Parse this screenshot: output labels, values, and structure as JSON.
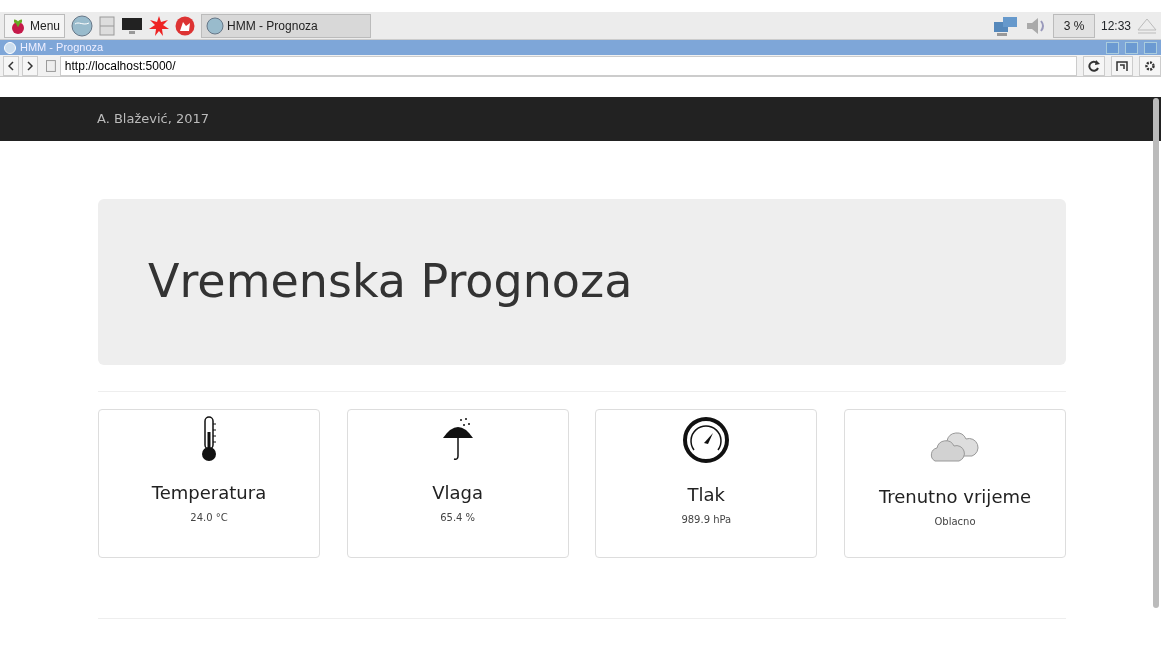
{
  "taskbar": {
    "menu_label": "Menu",
    "window_button": "HMM - Prognoza",
    "cpu": "3 %",
    "clock": "12:33"
  },
  "window": {
    "title": "HMM - Prognoza"
  },
  "browser": {
    "url": "http://localhost:5000/"
  },
  "navbar": {
    "brand": "A. Blažević, 2017"
  },
  "jumbotron": {
    "title": "Vremenska Prognoza"
  },
  "cards": [
    {
      "kind": "thermometer",
      "title": "Temperatura",
      "value": "24.0 °C"
    },
    {
      "kind": "umbrella",
      "title": "Vlaga",
      "value": "65.4 %"
    },
    {
      "kind": "gauge",
      "title": "Tlak",
      "value": "989.9 hPa"
    },
    {
      "kind": "cloud",
      "title": "Trenutno vrijeme",
      "value": "Oblacno"
    }
  ]
}
